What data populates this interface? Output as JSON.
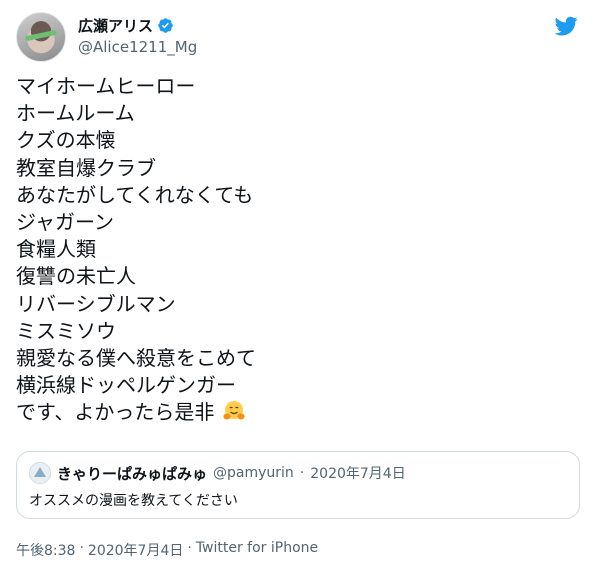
{
  "tweet": {
    "author": {
      "display_name": "広瀬アリス",
      "handle": "@Alice1211_Mg",
      "verified": true,
      "avatar_icon": "avatar"
    },
    "brand_icon": "twitter-bird-icon",
    "lines": [
      "マイホームヒーロー",
      "ホームルーム",
      "クズの本懐",
      "教室自爆クラブ",
      "あなたがしてくれなくても",
      "ジャガーン",
      "食糧人類",
      "復讐の未亡人",
      "リバーシブルマン",
      "ミスミソウ",
      "親愛なる僕へ殺意をこめて",
      "横浜線ドッペルゲンガー",
      "です、よかったら是非"
    ],
    "last_line_emoji": "hugging-face",
    "timestamp_time": "午後8:38",
    "timestamp_date": "2020年7月4日",
    "source": "Twitter for iPhone",
    "separator": "·"
  },
  "quote": {
    "display_name": "きゃりーぱみゅぱみゅ",
    "handle": "@pamyurin",
    "separator": "·",
    "date": "2020年7月4日",
    "text": "オススメの漫画を教えてください"
  },
  "colors": {
    "text": "#0f1419",
    "secondary": "#536471",
    "verified": "#1d9bf0",
    "border": "#cfd9de",
    "brand": "#1d9bf0"
  }
}
